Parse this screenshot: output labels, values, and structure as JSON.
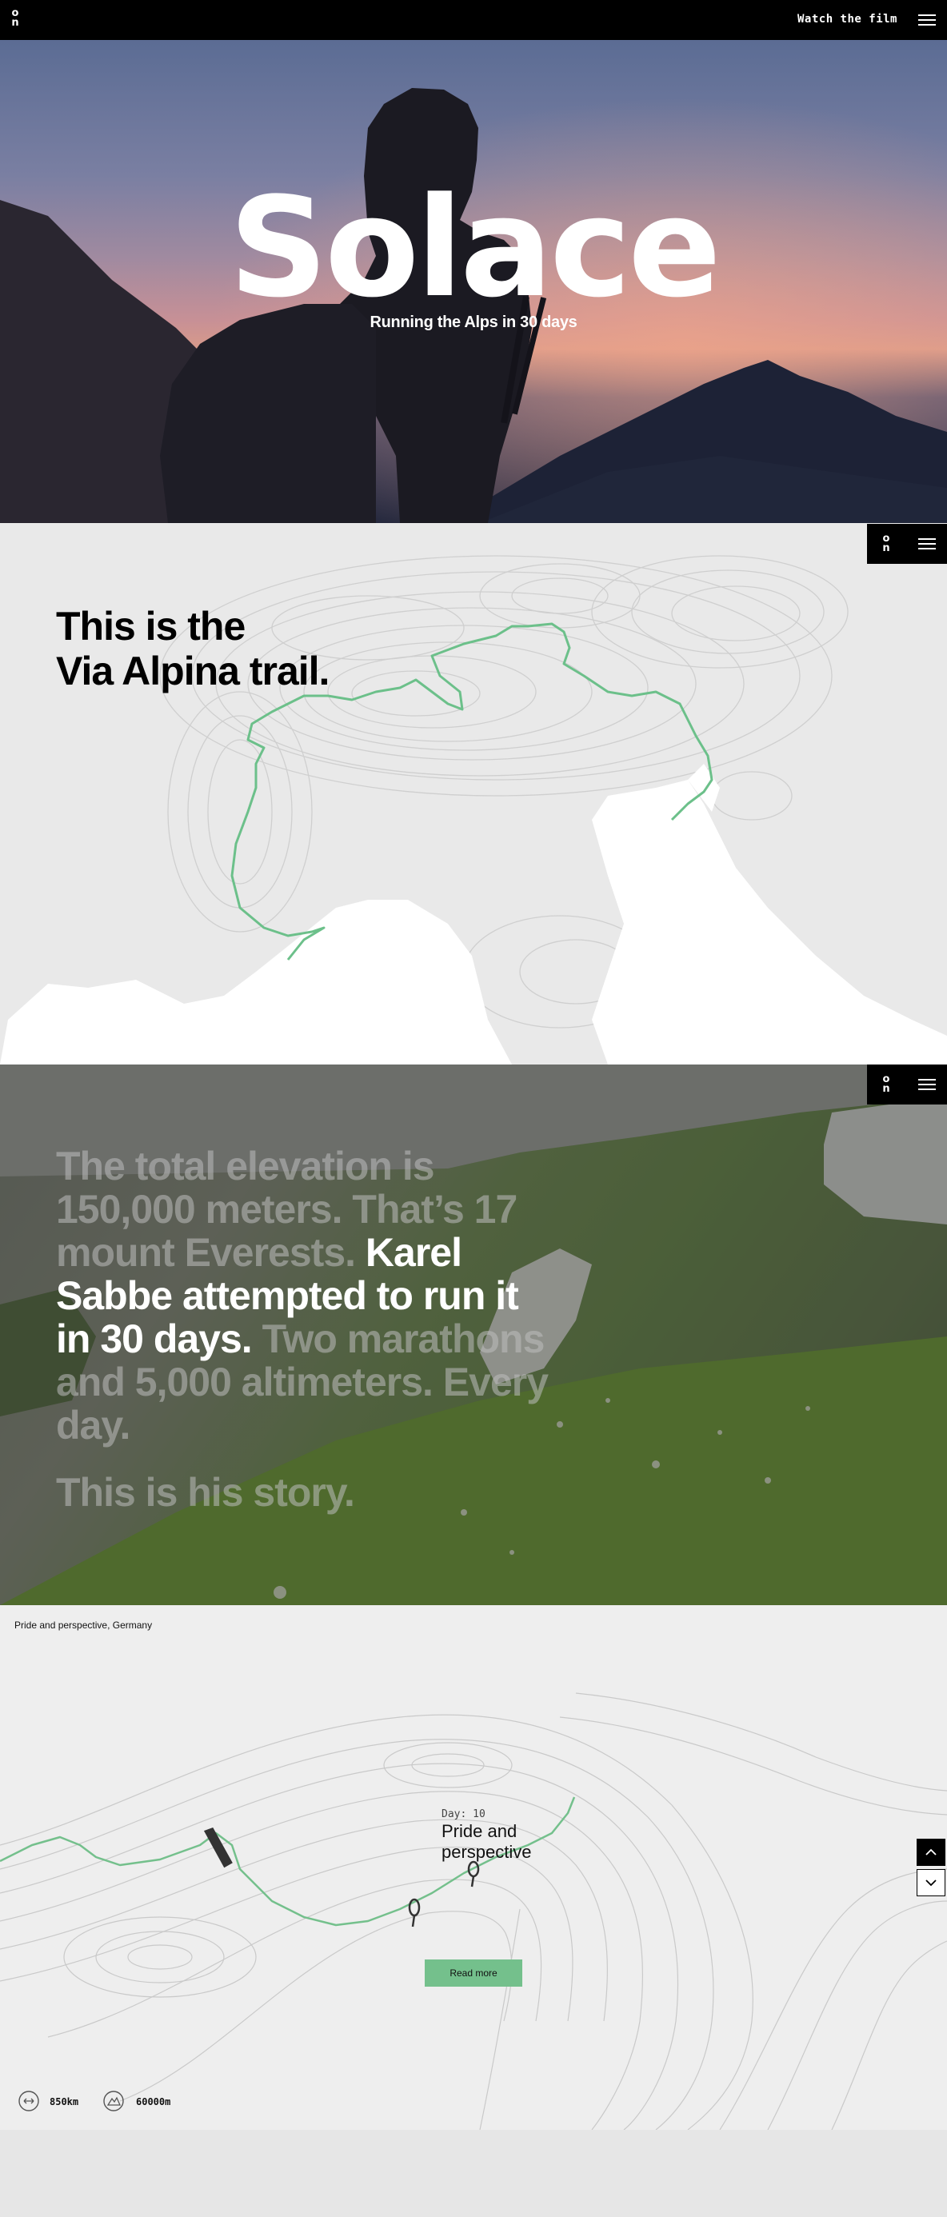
{
  "header": {
    "logo_text": "on",
    "watch_label": "Watch the film"
  },
  "hero": {
    "title": "Solace",
    "subtitle": "Running the Alps in 30 days"
  },
  "trail": {
    "title_line1": "This is the",
    "title_line2": "Via Alpina trail.",
    "trail_color": "#6cc08a"
  },
  "story": {
    "part1": "The total elevation is 150,000 meters. That’s 17 mount Everests.",
    "part2": "Karel Sabbe attempted to run it in 30 days.",
    "part3": "Two marathons and 5,000 altimeters. Every day.",
    "part4": "This is his story."
  },
  "stage": {
    "location": "Pride and perspective, Germany",
    "day": "Day: 10",
    "title_line1": "Pride and",
    "title_line2": "perspective",
    "read_more": "Read more",
    "distance": "850km",
    "elevation": "60000m",
    "accent": "#74c08c"
  },
  "icons": [
    "menu-icon",
    "chevron-up-icon",
    "chevron-down-icon",
    "distance-icon",
    "elevation-icon",
    "pin-icon"
  ]
}
